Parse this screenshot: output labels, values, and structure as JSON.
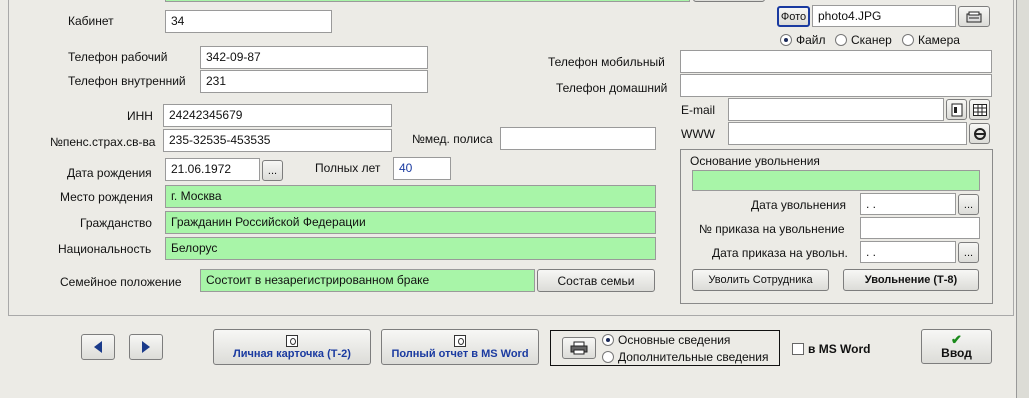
{
  "form": {
    "cabinet": {
      "label": "Кабинет",
      "value": "34"
    },
    "work_phone": {
      "label": "Телефон рабочий",
      "value": "342-09-87"
    },
    "internal_phone": {
      "label": "Телефон внутренний",
      "value": "231"
    },
    "inn": {
      "label": "ИНН",
      "value": "24242345679"
    },
    "pension": {
      "label": "№пенс.страх.св-ва",
      "value": "235-32535-453535"
    },
    "med_policy": {
      "label": "№мед. полиса",
      "value": ""
    },
    "birth_date": {
      "label": "Дата рождения",
      "value": "21.06.1972",
      "picker": "..."
    },
    "full_years": {
      "label": "Полных лет",
      "value": "40"
    },
    "birth_place": {
      "label": "Место рождения",
      "value": "г. Москва"
    },
    "citizenship": {
      "label": "Гражданство",
      "value": "Гражданин Российской Федерации"
    },
    "nationality": {
      "label": "Национальность",
      "value": "Белорус"
    },
    "marital": {
      "label": "Семейное положение",
      "value": "Состоит в незарегистрированном браке",
      "family_button": "Состав семьи"
    },
    "mobile_phone": {
      "label": "Телефон мобильный",
      "value": ""
    },
    "home_phone": {
      "label": "Телефон домашний",
      "value": ""
    },
    "email": {
      "label": "E-mail",
      "value": ""
    },
    "www": {
      "label": "WWW",
      "value": ""
    }
  },
  "photo": {
    "button": "Фото",
    "filename": "photo4.JPG",
    "sources": [
      {
        "label": "Файл",
        "selected": true
      },
      {
        "label": "Сканер",
        "selected": false
      },
      {
        "label": "Камера",
        "selected": false
      }
    ]
  },
  "dismissal": {
    "title": "Основание увольнения",
    "reason": "",
    "date": {
      "label": "Дата увольнения",
      "value": " .  ."
    },
    "order_no": {
      "label": "№ приказа на увольнение",
      "value": ""
    },
    "order_date": {
      "label": "Дата приказа на увольн.",
      "value": " .  ."
    },
    "dismiss_button": "Уволить Сотрудника",
    "t8_button": "Увольнение (Т-8)"
  },
  "bottom": {
    "personal_card": "Личная карточка (Т-2)",
    "full_report": "Полный отчет в MS Word",
    "print_options": [
      {
        "label": "Основные сведения",
        "selected": true
      },
      {
        "label": "Дополнительные сведения",
        "selected": false
      }
    ],
    "ms_word_check": {
      "label": "в MS Word",
      "checked": false
    },
    "enter_button": "Ввод"
  },
  "colors": {
    "green_field": "#a8f5a8",
    "accent_blue": "#1a3aa0"
  }
}
